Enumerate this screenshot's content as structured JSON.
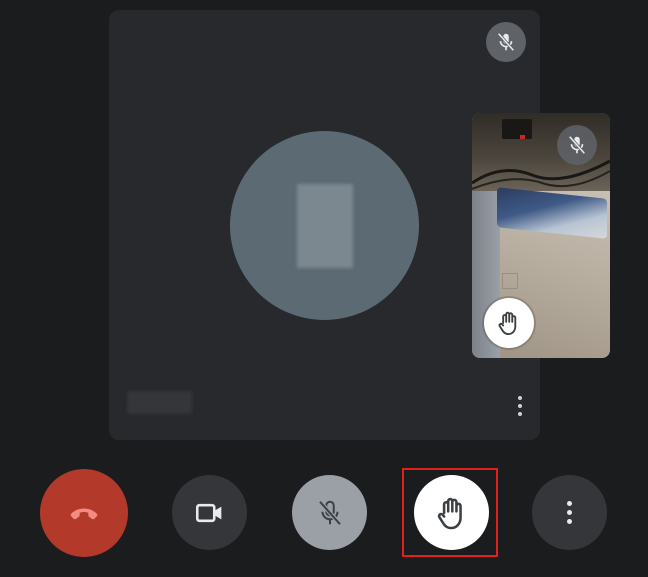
{
  "call": {
    "main_participant": {
      "mic_status_icon": "mic-off-icon",
      "avatar_icon": "avatar-icon",
      "more_options_icon": "more-vert-icon"
    },
    "self_view": {
      "mic_status_icon": "mic-off-icon",
      "hand_raised_icon": "raised-hand-icon"
    }
  },
  "controls": [
    {
      "name": "end-call",
      "icon": "phone-hangup-icon",
      "color": "#b3392b"
    },
    {
      "name": "camera",
      "icon": "videocam-icon",
      "color": "#35363a"
    },
    {
      "name": "microphone",
      "icon": "mic-off-icon",
      "color": "#9aa0a6"
    },
    {
      "name": "raise-hand",
      "icon": "raised-hand-icon",
      "color": "#ffffff",
      "highlighted": true
    },
    {
      "name": "more-options",
      "icon": "more-vert-icon",
      "color": "#35363a"
    }
  ],
  "colors": {
    "background": "#1b1c1e",
    "tile": "#28292c",
    "avatar": "#5b6a73",
    "highlight": "#e0201c"
  }
}
